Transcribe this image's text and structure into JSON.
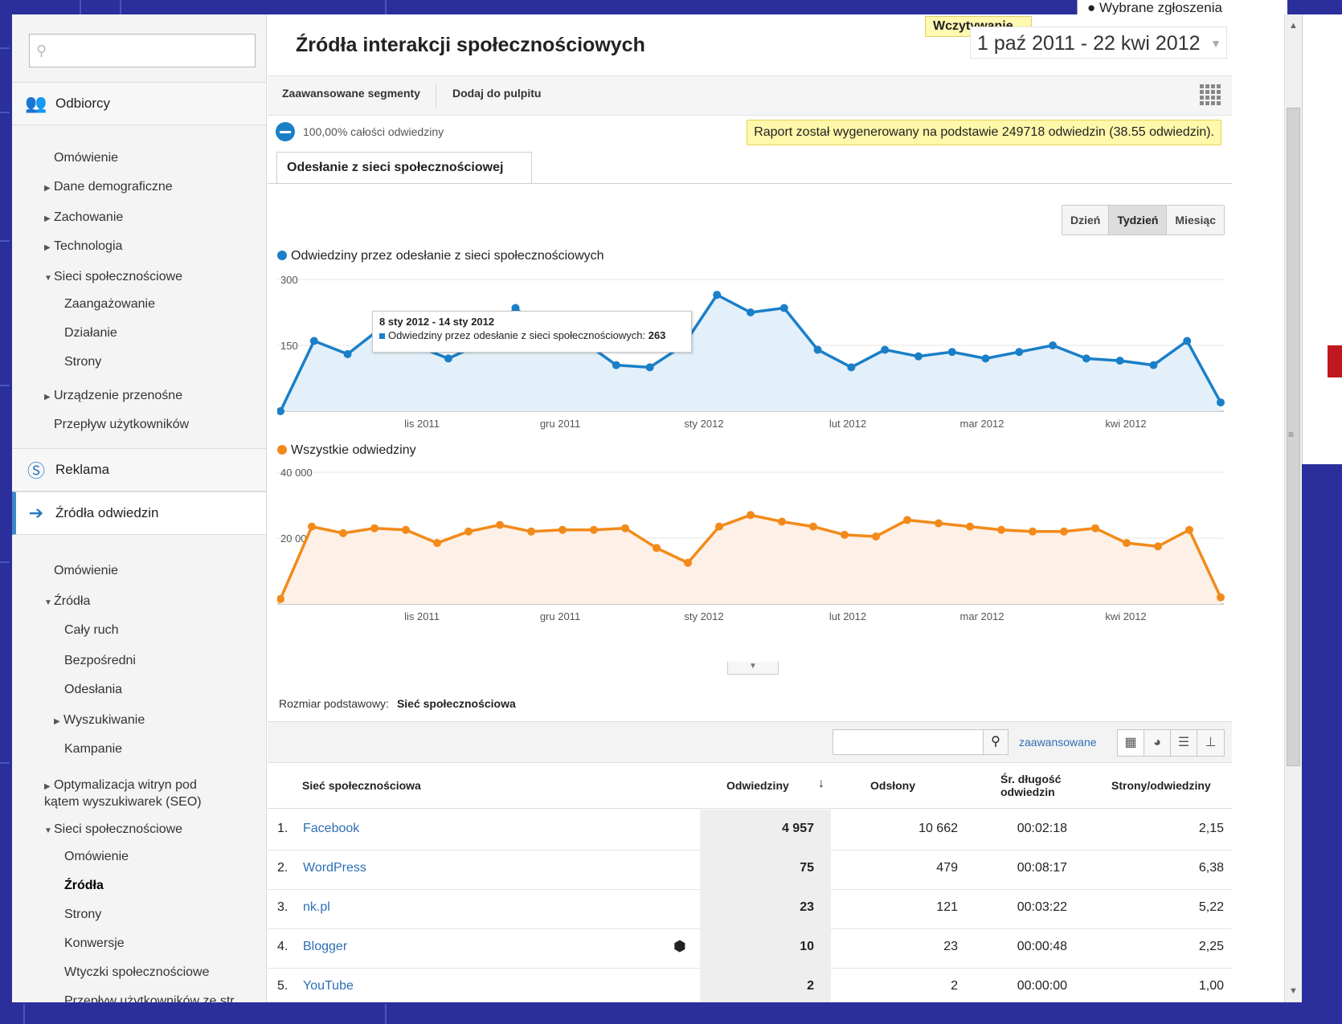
{
  "window": {
    "popup_peek": "Wybrane zgłoszenia"
  },
  "sidebar": {
    "search_placeholder": "",
    "sections": [
      {
        "label": "Odbiorcy",
        "icon": "audience-icon"
      },
      {
        "label": "Reklama",
        "icon": "dollar-icon"
      },
      {
        "label": "Źródła odwiedzin",
        "icon": "traffic-icon"
      }
    ],
    "audience_items": [
      "Omówienie",
      "Dane demograficzne",
      "Zachowanie",
      "Technologia",
      "Sieci społecznościowe",
      "Zaangażowanie",
      "Działanie",
      "Strony",
      "Urządzenie przenośne",
      "Przepływ użytkowników"
    ],
    "traffic_items": [
      "Omówienie",
      "Źródła",
      "Cały ruch",
      "Bezpośredni",
      "Odesłania",
      "Wyszukiwanie",
      "Kampanie",
      "Optymalizacja witryn pod",
      "kątem wyszukiwarek (SEO)",
      "Sieci społecznościowe",
      "Omówienie",
      "Źródła",
      "Strony",
      "Konwersje",
      "Wtyczki społecznościowe",
      "Przepływ użytkowników ze str"
    ]
  },
  "header": {
    "title": "Źródła interakcji społecznościowych",
    "loading": "Wczytywanie...",
    "date_range": "1 paź 2011 - 22 kwi 2012"
  },
  "toolbar": {
    "advanced_segments": "Zaawansowane segmenty",
    "add_to_dashboard": "Dodaj do pulpitu"
  },
  "segment": {
    "label": "100,00% całości odwiedziny"
  },
  "notice": "Raport został wygenerowany na podstawie 249718 odwiedzin (38.55 odwiedzin).",
  "tab": "Odesłanie z sieci społecznościowej",
  "granularity": {
    "day": "Dzień",
    "week": "Tydzień",
    "month": "Miesiąc",
    "selected": "Tydzień"
  },
  "colors": {
    "blue": "#1b7fc8",
    "orange": "#f28a1a",
    "link": "#2e6eb5"
  },
  "chart_data": [
    {
      "type": "area",
      "title": "Odwiedziny przez odesłanie z sieci społecznościowych",
      "ylim": [
        0,
        300
      ],
      "yticks": [
        "300",
        "150"
      ],
      "xticks": [
        "lis 2011",
        "gru 2011",
        "sty 2012",
        "lut 2012",
        "mar 2012",
        "kwi 2012"
      ],
      "series": [
        {
          "name": "Odwiedziny przez odesłanie z sieci społecznościowych",
          "values": [
            0,
            160,
            130,
            190,
            150,
            120,
            155,
            235,
            170,
            160,
            105,
            100,
            150,
            265,
            225,
            235,
            140,
            100,
            140,
            125,
            135,
            120,
            135,
            150,
            120,
            115,
            105,
            160,
            20
          ]
        }
      ],
      "tooltip": {
        "date": "8 sty 2012 - 14 sty 2012",
        "label": "Odwiedziny przez odesłanie z sieci społecznościowych:",
        "value": "263"
      }
    },
    {
      "type": "area",
      "title": "Wszystkie odwiedziny",
      "ylim": [
        0,
        40000
      ],
      "yticks": [
        "40 000",
        "20 000"
      ],
      "xticks": [
        "lis 2011",
        "gru 2011",
        "sty 2012",
        "lut 2012",
        "mar 2012",
        "kwi 2012"
      ],
      "series": [
        {
          "name": "Wszystkie odwiedziny",
          "values": [
            1500,
            23500,
            21500,
            23000,
            22500,
            18500,
            22000,
            24000,
            22000,
            22500,
            22500,
            23000,
            17000,
            12500,
            23500,
            27000,
            25000,
            23500,
            21000,
            20500,
            25500,
            24500,
            23500,
            22500,
            22000,
            22000,
            23000,
            18500,
            17500,
            22500,
            2000
          ]
        }
      ]
    }
  ],
  "dimension": {
    "label": "Rozmiar podstawowy:",
    "value": "Sieć społecznościowa"
  },
  "table_tools": {
    "search_placeholder": "",
    "advanced": "zaawansowane"
  },
  "table": {
    "headers": {
      "network": "Sieć społecznościowa",
      "visits": "Odwiedziny",
      "pageviews": "Odsłony",
      "avg_duration_1": "Śr. długość",
      "avg_duration_2": "odwiedzin",
      "pages_per_visit": "Strony/odwiedziny"
    },
    "rows": [
      {
        "index": "1.",
        "name": "Facebook",
        "visits": "4 957",
        "pageviews": "10 662",
        "duration": "00:02:18",
        "ppv": "2,15"
      },
      {
        "index": "2.",
        "name": "WordPress",
        "visits": "75",
        "pageviews": "479",
        "duration": "00:08:17",
        "ppv": "6,38"
      },
      {
        "index": "3.",
        "name": "nk.pl",
        "visits": "23",
        "pageviews": "121",
        "duration": "00:03:22",
        "ppv": "5,22"
      },
      {
        "index": "4.",
        "name": "Blogger",
        "visits": "10",
        "pageviews": "23",
        "duration": "00:00:48",
        "ppv": "2,25"
      },
      {
        "index": "5.",
        "name": "YouTube",
        "visits": "2",
        "pageviews": "2",
        "duration": "00:00:00",
        "ppv": "1,00"
      }
    ]
  }
}
